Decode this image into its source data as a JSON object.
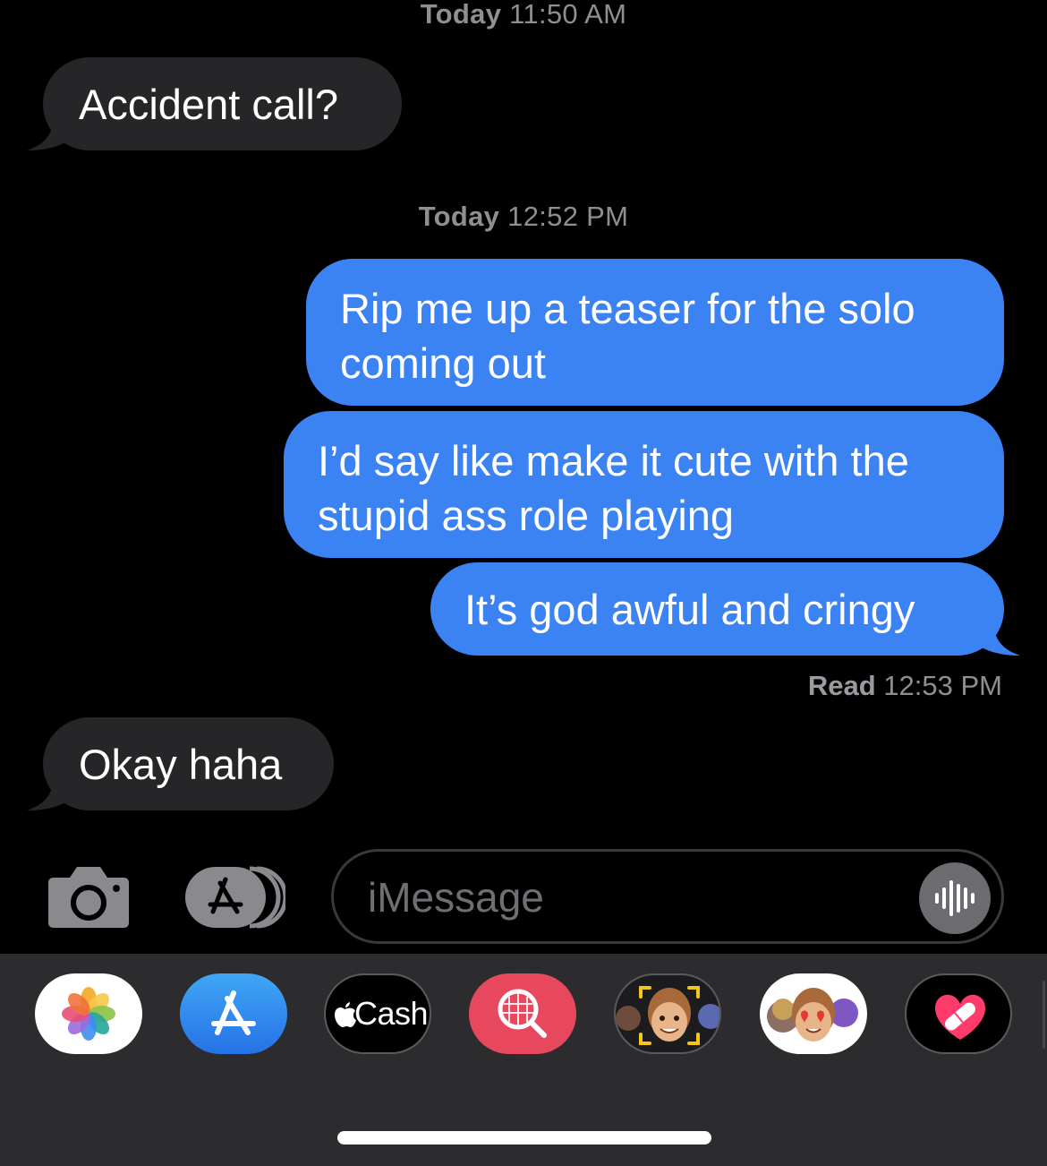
{
  "conversation": {
    "timestamp_1": {
      "day": "Today",
      "time": "11:50 AM"
    },
    "timestamp_2": {
      "day": "Today",
      "time": "12:52 PM"
    },
    "messages": [
      {
        "direction": "received",
        "text": "Accident call?"
      },
      {
        "direction": "sent",
        "lines": [
          "Rip me up a teaser for the solo",
          "coming out"
        ]
      },
      {
        "direction": "sent",
        "lines": [
          "I’d say like make it cute with the",
          "stupid ass role playing"
        ]
      },
      {
        "direction": "sent",
        "text": "It’s god awful and cringy"
      },
      {
        "direction": "received",
        "text": "Okay haha"
      }
    ],
    "read_receipt": {
      "label": "Read",
      "time": "12:53 PM"
    }
  },
  "input_bar": {
    "camera_icon": "camera-icon",
    "apps_icon": "app-store-icon",
    "placeholder": "iMessage",
    "audio_icon": "waveform-icon"
  },
  "app_drawer": {
    "apps": [
      {
        "name": "Photos",
        "icon": "photos-icon"
      },
      {
        "name": "App Store",
        "icon": "app-store-icon"
      },
      {
        "name": "Apple Cash",
        "label": "Cash",
        "icon": "apple-cash-icon"
      },
      {
        "name": "Images Search",
        "icon": "image-search-icon"
      },
      {
        "name": "Memoji",
        "icon": "memoji-icon"
      },
      {
        "name": "Memoji Stickers",
        "icon": "memoji-stickers-icon"
      },
      {
        "name": "Digital Touch",
        "icon": "heart-icon"
      }
    ]
  },
  "colors": {
    "background": "#000000",
    "received_bubble": "#262629",
    "sent_bubble": "#3b82f2",
    "timestamp": "#8e8e93",
    "drawer": "#2c2c2e"
  }
}
